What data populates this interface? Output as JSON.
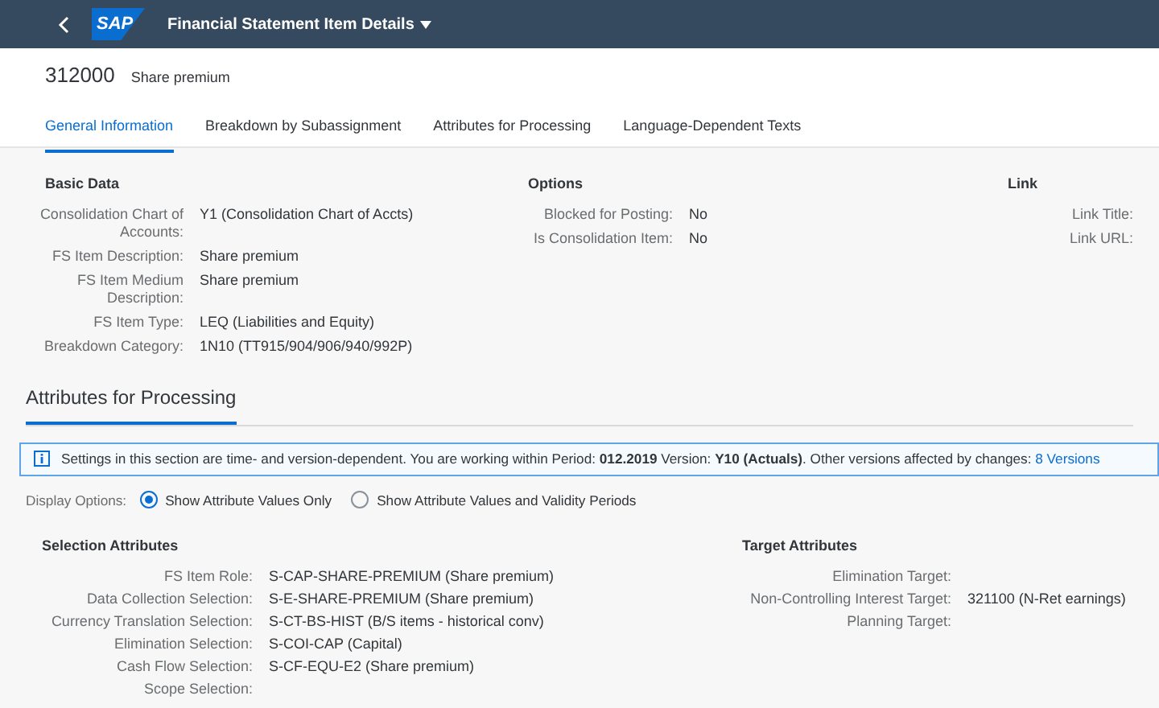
{
  "shell": {
    "logo": "SAP",
    "title": "Financial Statement Item Details"
  },
  "object": {
    "id": "312000",
    "name": "Share premium"
  },
  "tabs": [
    {
      "label": "General Information",
      "selected": true
    },
    {
      "label": "Breakdown by Subassignment",
      "selected": false
    },
    {
      "label": "Attributes for Processing",
      "selected": false
    },
    {
      "label": "Language-Dependent Texts",
      "selected": false
    }
  ],
  "basic_data": {
    "title": "Basic Data",
    "fields": [
      {
        "label": "Consolidation Chart of Accounts:",
        "value": "Y1 (Consolidation Chart of Accts)"
      },
      {
        "label": "FS Item Description:",
        "value": "Share premium"
      },
      {
        "label": "FS Item Medium Description:",
        "value": "Share premium"
      },
      {
        "label": "FS Item Type:",
        "value": "LEQ (Liabilities and Equity)"
      },
      {
        "label": "Breakdown Category:",
        "value": "1N10 (TT915/904/906/940/992P)"
      }
    ]
  },
  "options": {
    "title": "Options",
    "fields": [
      {
        "label": "Blocked for Posting:",
        "value": "No"
      },
      {
        "label": "Is Consolidation Item:",
        "value": "No"
      }
    ]
  },
  "link": {
    "title": "Link",
    "fields": [
      {
        "label": "Link Title:"
      },
      {
        "label": "Link URL:"
      }
    ]
  },
  "attributes_section": {
    "title": "Attributes for Processing",
    "info": "Settings in this section are time- and version-dependent. You are working within Period: **012.2019** Version: **Y10 (Actuals)**. Other versions affected by changes:",
    "info_link": "8 Versions"
  },
  "display_options": {
    "label": "Display Options:",
    "options": [
      {
        "label": "Show Attribute Values Only",
        "selected": true
      },
      {
        "label": "Show Attribute Values and Validity Periods",
        "selected": false
      }
    ]
  },
  "selection_attributes": {
    "title": "Selection Attributes",
    "fields": [
      {
        "label": "FS Item Role:",
        "value": "S-CAP-SHARE-PREMIUM (Share premium)"
      },
      {
        "label": "Data Collection Selection:",
        "value": "S-E-SHARE-PREMIUM (Share premium)"
      },
      {
        "label": "Currency Translation Selection:",
        "value": "S-CT-BS-HIST (B/S items - historical conv)"
      },
      {
        "label": "Elimination Selection:",
        "value": "S-COI-CAP (Capital)"
      },
      {
        "label": "Cash Flow Selection:",
        "value": "S-CF-EQU-E2 (Share premium)"
      },
      {
        "label": "Scope Selection:"
      }
    ]
  },
  "target_attributes": {
    "title": "Target Attributes",
    "fields": [
      {
        "label": "Elimination Target:"
      },
      {
        "label": "Non-Controlling Interest Target:",
        "value": "321100 (N-Ret earnings)"
      },
      {
        "label": "Planning Target:"
      }
    ]
  }
}
